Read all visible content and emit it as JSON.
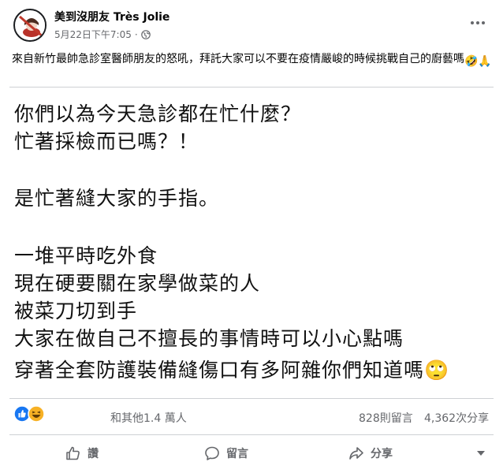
{
  "post": {
    "page_name": "美到沒朋友 Très Jolie",
    "timestamp": "5月22日下午7:05",
    "separator": "·",
    "caption": "來自新竹最帥急診室醫師朋友的怒吼，拜託大家可以不要在疫情嚴峻的時候挑戰自己的廚藝嗎",
    "caption_emojis": "🤣🙏",
    "image_text": {
      "line1": "你們以為今天急診都在忙什麼？",
      "line2": "忙著採檢而已嗎？！",
      "line3": "是忙著縫大家的手指。",
      "line4": "一堆平時吃外食",
      "line5": "現在硬要關在家學做菜的人",
      "line6": "被菜刀切到手",
      "line7": "大家在做自己不擅長的事情時可以小心點嗎",
      "line8": "穿著全套防護裝備縫傷口有多阿雜你們知道嗎",
      "line8_emoji": "🙄"
    }
  },
  "stats": {
    "reactions_text": "和其他1.4 萬人",
    "comments_text": "828則留言",
    "shares_text": "4,362次分享"
  },
  "actions": {
    "like_label": "讚",
    "comment_label": "留言",
    "share_label": "分享"
  },
  "colors": {
    "secondary_text": "#65676b",
    "like_blue": "#1877f2",
    "haha_yellow": "#f7b125",
    "divider": "#ced0d4"
  },
  "icons": [
    "avatar-logo",
    "globe-icon",
    "more-options-icon",
    "like-reaction-icon",
    "haha-reaction-icon",
    "thumbs-up-icon",
    "comment-icon",
    "share-icon",
    "caret-down-icon"
  ]
}
